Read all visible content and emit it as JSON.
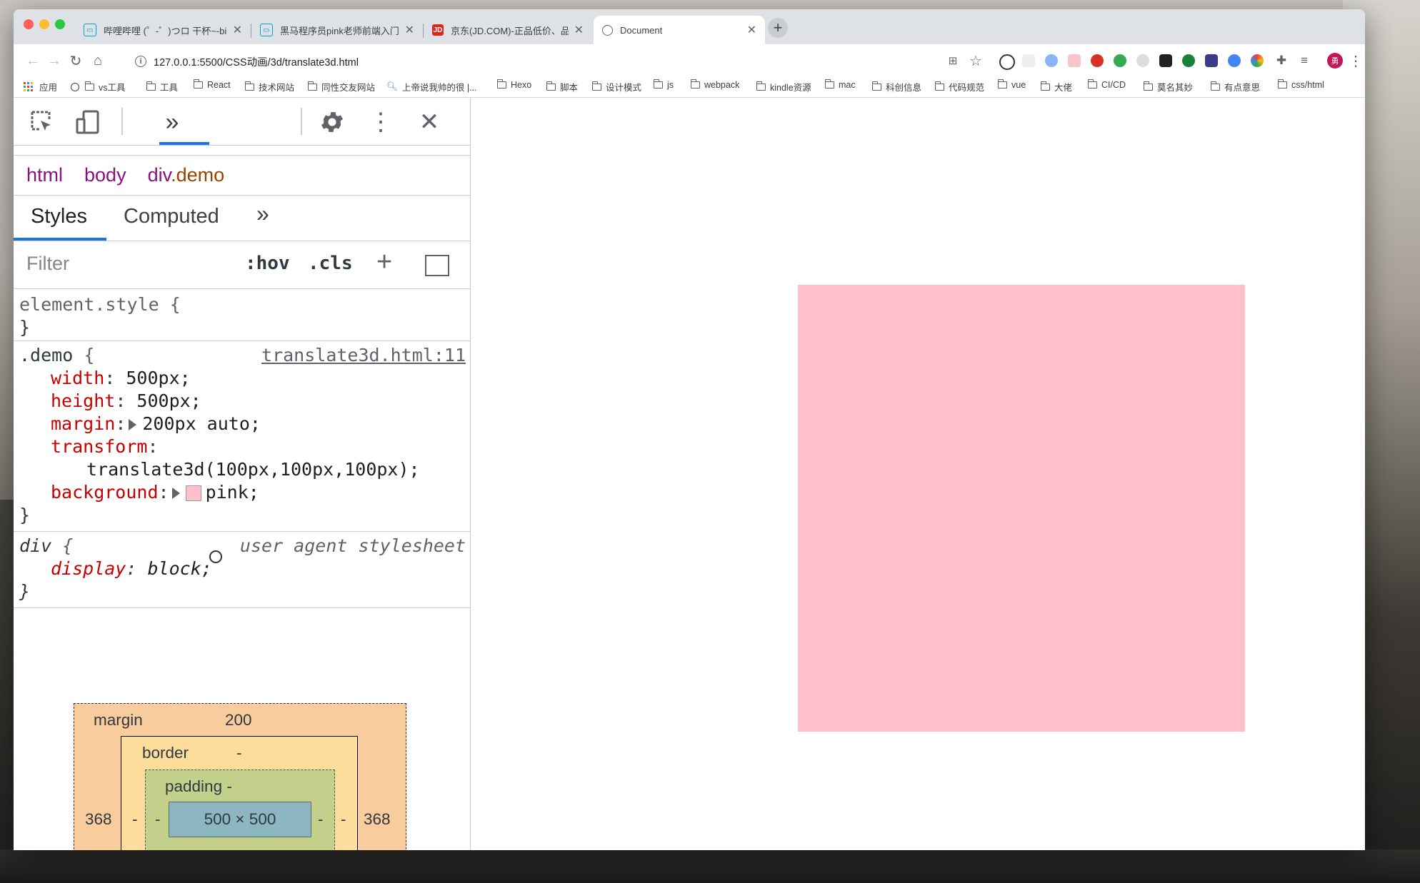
{
  "browser": {
    "tabs": [
      {
        "title": "哔哩哔哩 (゜-゜)つロ 干杯~-bili",
        "icon": "bilibili-icon"
      },
      {
        "title": "黑马程序员pink老师前端入门视频",
        "icon": "bilibili-icon"
      },
      {
        "title": "京东(JD.COM)-正品低价、品质",
        "icon": "jd-icon",
        "badge": "JD"
      },
      {
        "title": "Document",
        "icon": "globe-icon"
      }
    ],
    "url": "127.0.0.1:5500/CSS动画/3d/translate3d.html",
    "profile_initial": "勇",
    "bookmarks": [
      "应用",
      "vs工具",
      "工具",
      "React",
      "技术网站",
      "同性交友网站",
      "上帝说我帅的很 |...",
      "Hexo",
      "脚本",
      "设计模式",
      "js",
      "webpack",
      "kindle资源",
      "mac",
      "科创信息",
      "代码规范",
      "vue",
      "大佬",
      "CI/CD",
      "莫名其妙",
      "有点意思",
      "css/html"
    ]
  },
  "devtools": {
    "breadcrumbs": {
      "html": "html",
      "body": "body",
      "div_tag": "div",
      "div_class": ".demo"
    },
    "tabs": {
      "styles": "Styles",
      "computed": "Computed"
    },
    "filter": {
      "placeholder": "Filter",
      "hov": ":hov",
      "cls": ".cls"
    },
    "rules": {
      "element_style_open": "element.style {",
      "close": "}",
      "demo_selector": ".demo",
      "open_brace": " {",
      "demo_source": "translate3d.html:11",
      "width_prop": "width",
      "width_val": "500px;",
      "height_prop": "height",
      "height_val": "500px;",
      "margin_prop": "margin",
      "margin_val": "200px auto;",
      "transform_prop": "transform",
      "transform_val": "translate3d(100px,100px,100px);",
      "background_prop": "background",
      "background_val": "pink;",
      "div_selector": "div",
      "ua_label": "user agent stylesheet",
      "display_prop": "display",
      "display_val": "block;"
    },
    "box_model": {
      "margin_label": "margin",
      "margin_top": "200",
      "border_label": "border",
      "border_value": "-",
      "padding_label": "padding -",
      "content": "500 × 500",
      "margin_left": "368",
      "margin_right": "368",
      "dash": "-"
    }
  },
  "colors": {
    "accent": "#1a73e8",
    "demo_background": "#ffc0cb"
  }
}
